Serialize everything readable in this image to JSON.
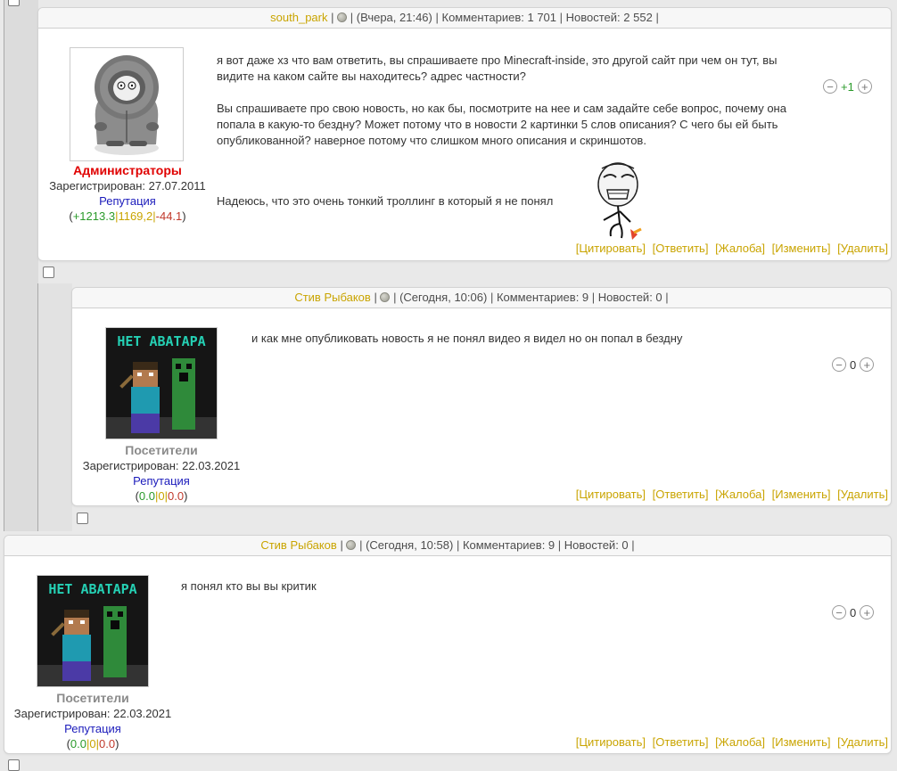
{
  "labels": {
    "reputation": "Репутация",
    "registered_prefix": "Зарегистрирован: "
  },
  "actions": [
    "[Цитировать]",
    "[Ответить]",
    "[Жалоба]",
    "[Изменить]",
    "[Удалить]"
  ],
  "comments": [
    {
      "author": "south_park",
      "time": "(Вчера, 21:46)",
      "comments_count": "Комментариев: 1 701",
      "news_count": "Новостей: 2 552",
      "group": "Администраторы",
      "registered": "Зарегистрирован: 27.07.2011",
      "rep_open": "(",
      "rep_pos": "+1213.3",
      "rep_mid": "1169,2",
      "rep_neg": "-44.1",
      "rep_close": ")",
      "avatar_icon": "kenny-avatar-icon",
      "text_p1": "я вот даже хз что вам ответить, вы спрашиваете про Minecraft-inside, это другой сайт при чем он тут, вы видите на каком сайте вы находитесь? адрес частности?",
      "text_p2": "Вы спрашиваете про свою новость, но как бы, посмотрите на нее и сам задайте себе вопрос, почему она попала в какую-то бездну? Может потому что в новости 2 картинки 5 слов описания? С чего бы ей быть опубликованной? наверное потому что слишком много описания и скриншотов.",
      "text_p3": "Надеюсь, что это очень тонкий троллинг в который я не понял",
      "rating": "+1"
    },
    {
      "author": "Стив Рыбаков",
      "time": "(Сегодня, 10:06)",
      "comments_count": "Комментариев: 9",
      "news_count": "Новостей: 0",
      "group": "Посетители",
      "registered": "Зарегистрирован: 22.03.2021",
      "rep_open": "(",
      "rep_pos": "0.0",
      "rep_mid": "0",
      "rep_neg": "0.0",
      "rep_close": ")",
      "avatar_text": "НЕТ АВАТАРА",
      "text_p1": "и как мне опубликовать новость я не понял видео я видел но он попал в бездну",
      "rating": "0"
    },
    {
      "author": "Стив Рыбаков",
      "time": "(Сегодня, 10:58)",
      "comments_count": "Комментариев: 9",
      "news_count": "Новостей: 0",
      "group": "Посетители",
      "registered": "Зарегистрирован: 22.03.2021",
      "rep_open": "(",
      "rep_pos": "0.0",
      "rep_mid": "0",
      "rep_neg": "0.0",
      "rep_close": ")",
      "avatar_text": "НЕТ АВАТАРА",
      "text_p1": "я понял кто вы вы критик",
      "rating": "0"
    }
  ],
  "colors": {
    "accent": "#c9a400",
    "admin": "#e00000",
    "positive": "#2a9a2a",
    "negative": "#c0392b",
    "reputation_link": "#1b1bbb"
  }
}
